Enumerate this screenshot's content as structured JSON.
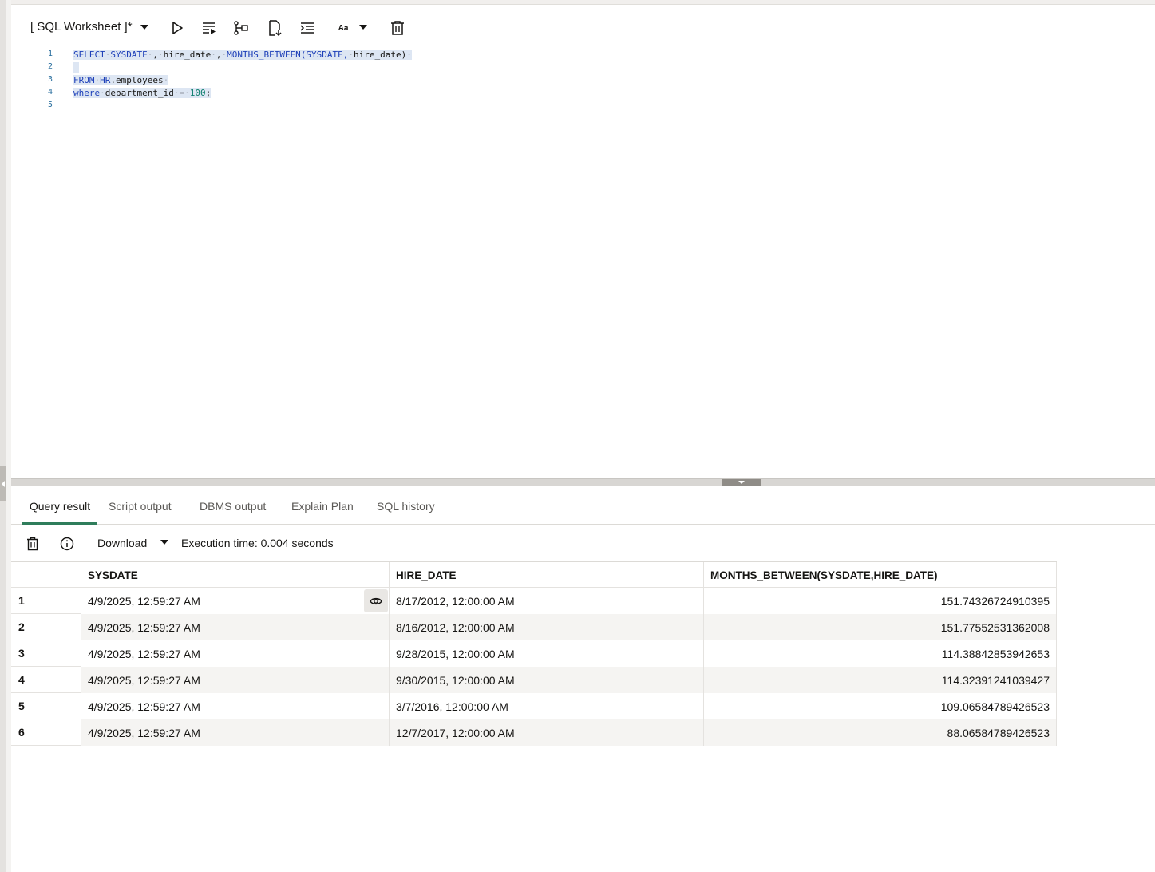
{
  "worksheet": {
    "title": "[ SQL Worksheet ]*",
    "aa_label": "Aa"
  },
  "toolbar_icons": [
    "run-statement-icon",
    "run-script-icon",
    "explain-plan-icon",
    "autotrace-icon",
    "format-icon",
    "font-case-icon",
    "clear-icon"
  ],
  "editor": {
    "lines": [
      {
        "n": "1"
      },
      {
        "n": "2"
      },
      {
        "n": "3"
      },
      {
        "n": "4"
      },
      {
        "n": "5"
      }
    ]
  },
  "tabs": [
    {
      "label": "Query result",
      "active": true
    },
    {
      "label": "Script output"
    },
    {
      "label": "DBMS output"
    },
    {
      "label": "Explain Plan"
    },
    {
      "label": "SQL history"
    }
  ],
  "results": {
    "download_label": "Download",
    "execution_time": "Execution time: 0.004 seconds",
    "columns": [
      "SYSDATE",
      "HIRE_DATE",
      "MONTHS_BETWEEN(SYSDATE,HIRE_DATE)"
    ],
    "rows": [
      {
        "num": "1",
        "sysdate": "4/9/2025, 12:59:27 AM",
        "hire_date": "8/17/2012, 12:00:00 AM",
        "months": "151.74326724910395"
      },
      {
        "num": "2",
        "sysdate": "4/9/2025, 12:59:27 AM",
        "hire_date": "8/16/2012, 12:00:00 AM",
        "months": "151.77552531362008"
      },
      {
        "num": "3",
        "sysdate": "4/9/2025, 12:59:27 AM",
        "hire_date": "9/28/2015, 12:00:00 AM",
        "months": "114.38842853942653"
      },
      {
        "num": "4",
        "sysdate": "4/9/2025, 12:59:27 AM",
        "hire_date": "9/30/2015, 12:00:00 AM",
        "months": "114.32391241039427"
      },
      {
        "num": "5",
        "sysdate": "4/9/2025, 12:59:27 AM",
        "hire_date": "3/7/2016, 12:00:00 AM",
        "months": "109.06584789426523"
      },
      {
        "num": "6",
        "sysdate": "4/9/2025, 12:59:27 AM",
        "hire_date": "12/7/2017, 12:00:00 AM",
        "months": "88.06584789426523"
      }
    ]
  },
  "code": {
    "l1_select": "SELECT",
    "l1_sysdate": "SYSDATE",
    "l1_hire": "hire_date",
    "l1_months": "MONTHS_BETWEEN(SYSDATE,",
    "l1_hire2": "hire_date)",
    "l3_from": "FROM",
    "l3_hr": "HR",
    "l3_emp": ".employees",
    "l4_where": "where",
    "l4_dept": "department_id",
    "l4_eq": "=",
    "l4_num": "100",
    "l4_semi": ";",
    "comma": ","
  },
  "colors": {
    "accent_tab": "#2f7d5b",
    "keyword": "#1d3fb8",
    "line_number": "#2a6f9e",
    "selection": "#dde6f3"
  }
}
